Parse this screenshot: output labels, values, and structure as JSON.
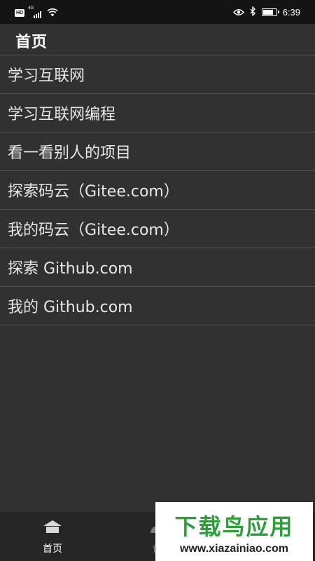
{
  "status_bar": {
    "hd_badge": "HD",
    "network_type": "4G",
    "time": "6:39",
    "icons": [
      "hd-icon",
      "signal-icon",
      "wifi-icon",
      "eye-icon",
      "bluetooth-icon",
      "battery-icon"
    ],
    "battery_level": 0.7
  },
  "header": {
    "title": "首页"
  },
  "menu": {
    "items": [
      {
        "label": "学习互联网"
      },
      {
        "label": "学习互联网编程"
      },
      {
        "label": "看一看别人的项目"
      },
      {
        "label": "探索码云（Gitee.com）"
      },
      {
        "label": "我的码云（Gitee.com）"
      },
      {
        "label": "探索 Github.com"
      },
      {
        "label": "我的 Github.com"
      }
    ]
  },
  "bottom_nav": {
    "tabs": [
      {
        "label": "首页",
        "icon": "home-icon",
        "active": true
      },
      {
        "label": "创",
        "icon": "create-icon",
        "active": false
      }
    ]
  },
  "watermark": {
    "brand": "下载鸟应用",
    "url": "www.xiazainiao.com"
  },
  "colors": {
    "background": "#313131",
    "status_bar": "#141414",
    "bottom_nav": "#262626",
    "text": "#e8e8e8",
    "divider": "#4d4d4d",
    "watermark_green": "#2e9e3a"
  }
}
